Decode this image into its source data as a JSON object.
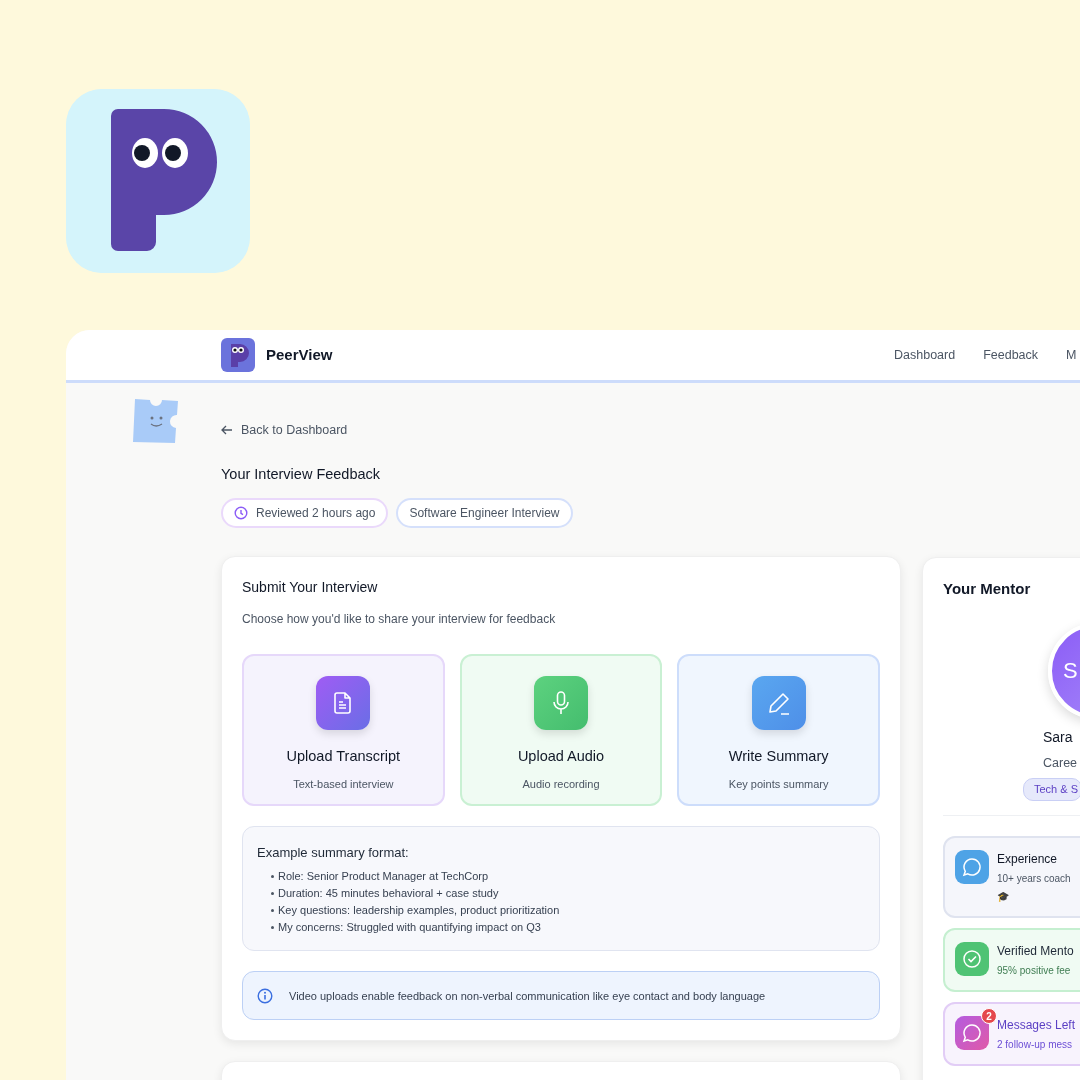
{
  "nav": {
    "brand": "PeerView",
    "links": [
      "Dashboard",
      "Feedback",
      "M"
    ]
  },
  "back_link": "Back to Dashboard",
  "page_title": "Your Interview Feedback",
  "tags": [
    {
      "label": "Reviewed 2 hours ago",
      "kind": "clock"
    },
    {
      "label": "Software Engineer Interview",
      "kind": "plain"
    }
  ],
  "submit": {
    "title": "Submit Your Interview",
    "subtitle": "Choose how you'd like to share your interview for feedback",
    "options": [
      {
        "kind": "transcript",
        "title": "Upload Transcript",
        "subtitle": "Text-based interview"
      },
      {
        "kind": "audio",
        "title": "Upload Audio",
        "subtitle": "Audio recording"
      },
      {
        "kind": "summary",
        "title": "Write Summary",
        "subtitle": "Key points summary"
      }
    ],
    "example": {
      "title": "Example summary format:",
      "items": [
        "Role: Senior Product Manager at TechCorp",
        "Duration: 45 minutes behavioral + case study",
        "Key questions: leadership examples, product prioritization",
        "My concerns: Struggled with quantifying impact on Q3"
      ]
    },
    "notice": "Video uploads enable feedback on non-verbal communication like eye contact and body language"
  },
  "mentor": {
    "title": "Your Mentor",
    "initial": "S",
    "name": "Sara",
    "role": "Caree",
    "tag": "Tech & S",
    "stats": [
      {
        "kind": "experience",
        "title": "Experience",
        "text": "10+ years coach",
        "note": "🎓"
      },
      {
        "kind": "verified",
        "title": "Verified Mento",
        "text": "95% positive fee"
      },
      {
        "kind": "messages",
        "title": "Messages Left",
        "text": "2 follow-up mess",
        "badge": "2"
      }
    ]
  }
}
